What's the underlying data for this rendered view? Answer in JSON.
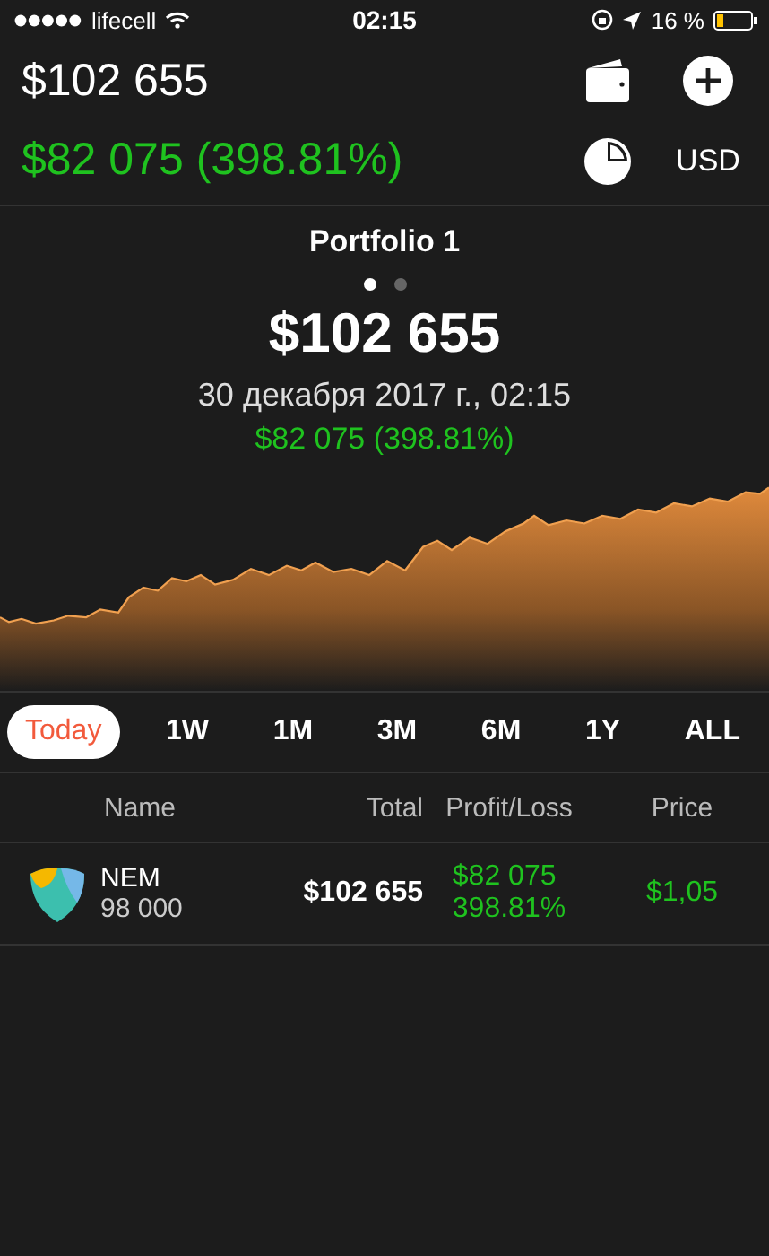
{
  "status_bar": {
    "carrier": "lifecell",
    "time": "02:15",
    "battery": "16 %"
  },
  "header": {
    "total": "$102 655",
    "change": "$82 075 (398.81%)",
    "currency": "USD"
  },
  "portfolio": {
    "title": "Portfolio 1",
    "pages": [
      {
        "selected": true
      },
      {
        "selected": false
      }
    ],
    "total": "$102 655",
    "date": "30 декабря 2017 г., 02:15",
    "change": "$82 075 (398.81%)"
  },
  "ranges": [
    {
      "label": "Today",
      "selected": true
    },
    {
      "label": "1W",
      "selected": false
    },
    {
      "label": "1M",
      "selected": false
    },
    {
      "label": "3M",
      "selected": false
    },
    {
      "label": "6M",
      "selected": false
    },
    {
      "label": "1Y",
      "selected": false
    },
    {
      "label": "ALL",
      "selected": false
    }
  ],
  "table": {
    "columns": [
      "Name",
      "Total",
      "Profit/Loss",
      "Price"
    ],
    "rows": [
      {
        "name": "NEM",
        "amount": "98 000",
        "total": "$102 655",
        "profit": "$82 075",
        "percent": "398.81%",
        "price": "$1,05"
      }
    ]
  }
}
